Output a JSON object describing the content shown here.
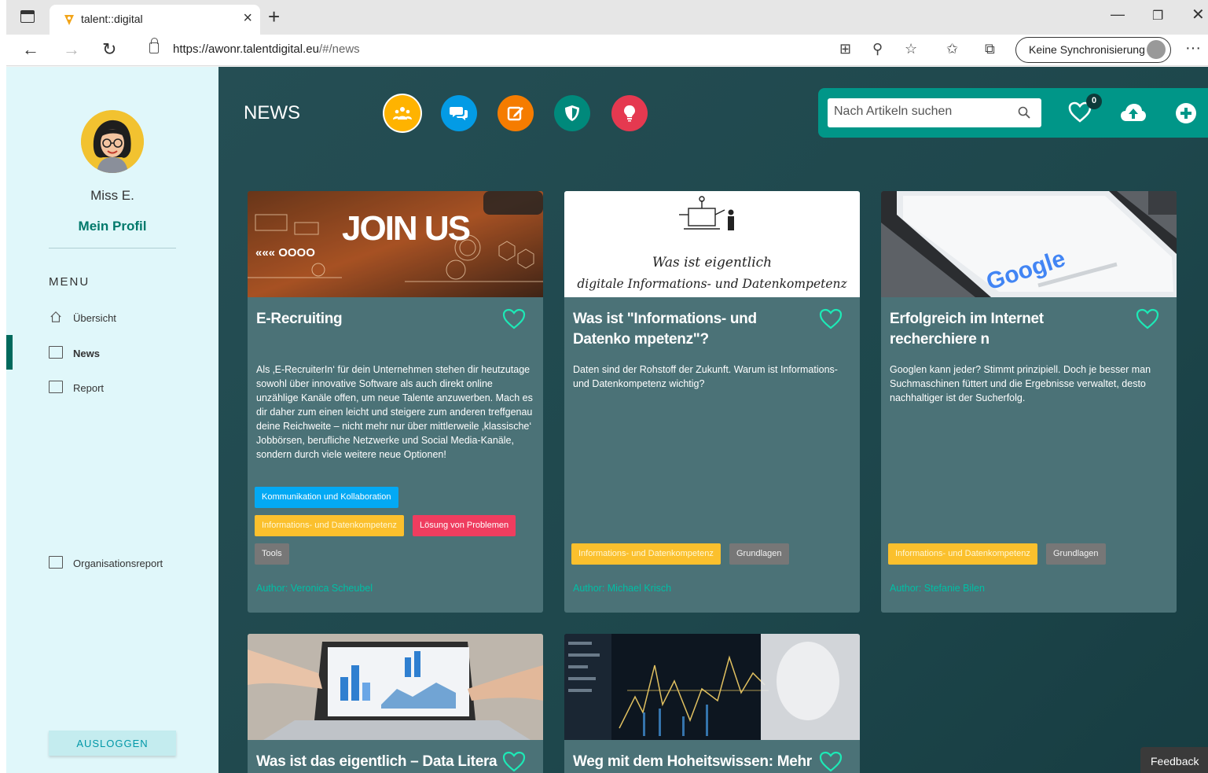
{
  "browser": {
    "tab_title": "talent::digital",
    "url_host": "https://awonr.talentdigital.eu",
    "url_path": "/#/news",
    "sync_label": "Keine Synchronisierung"
  },
  "sidebar": {
    "user_name": "Miss E.",
    "profile_link": "Mein Profil",
    "menu_heading": "MENU",
    "items": [
      {
        "label": "Übersicht",
        "icon": "home-icon"
      },
      {
        "label": "News",
        "icon": "news-icon"
      },
      {
        "label": "Report",
        "icon": "report-icon"
      }
    ],
    "org_report": "Organisationsreport",
    "logout": "AUSLOGGEN"
  },
  "header": {
    "title": "NEWS",
    "categories": [
      {
        "icon": "collaboration-icon",
        "color": "#ffb300"
      },
      {
        "icon": "chat-icon",
        "color": "#039be5"
      },
      {
        "icon": "edit-icon",
        "color": "#f57c00"
      },
      {
        "icon": "shield-icon",
        "color": "#00897b"
      },
      {
        "icon": "lightbulb-icon",
        "color": "#e53950"
      }
    ],
    "search_placeholder": "Nach Artikeln suchen",
    "favorites_count": "0"
  },
  "cards": [
    {
      "image_text": "JOIN US",
      "title": "E-Recruiting",
      "text": "Als ‚E-RecruiterIn‘ für dein Unternehmen stehen dir heutzutage sowohl über innovative Software als auch direkt online unzählige Kanäle offen, um neue Talente anzuwerben. Mach es dir daher zum einen leicht und steigere zum anderen treffgenau deine Reichweite – nicht mehr nur über mittlerweile ‚klassische‘ Jobbörsen, berufliche Netzwerke und Social Media-Kanäle, sondern durch viele weitere neue Optionen!",
      "tags": [
        "Kommunikation und Kollaboration",
        "Informations- und Datenkompetenz",
        "Lösung von Problemen",
        "Tools"
      ],
      "author": "Author: Veronica Scheubel"
    },
    {
      "image_text_1": "Was ist eigentlich",
      "image_text_2": "digitale Informations- und Datenkompetenz",
      "title": "Was ist \"Informations- und Datenko mpetenz\"?",
      "text": "Daten sind der Rohstoff der Zukunft. Warum ist Informations- und Datenkompetenz wichtig?",
      "tags": [
        "Informations- und Datenkompetenz",
        "Grundlagen"
      ],
      "author": "Author: Michael Krisch"
    },
    {
      "image_text": "Google",
      "title": "Erfolgreich im Internet recherchiere n",
      "text": "Googlen kann jeder? Stimmt prinzipiell. Doch je besser man Suchmaschinen füttert und die Ergebnisse verwaltet, desto nachhaltiger ist der Sucherfolg.",
      "tags": [
        "Informations- und Datenkompetenz",
        "Grundlagen"
      ],
      "author": "Author: Stefanie Bilen"
    },
    {
      "title": "Was ist das eigentlich – Data Litera"
    },
    {
      "title": "Weg mit dem Hoheitswissen: Mehr"
    }
  ],
  "feedback": "Feedback"
}
